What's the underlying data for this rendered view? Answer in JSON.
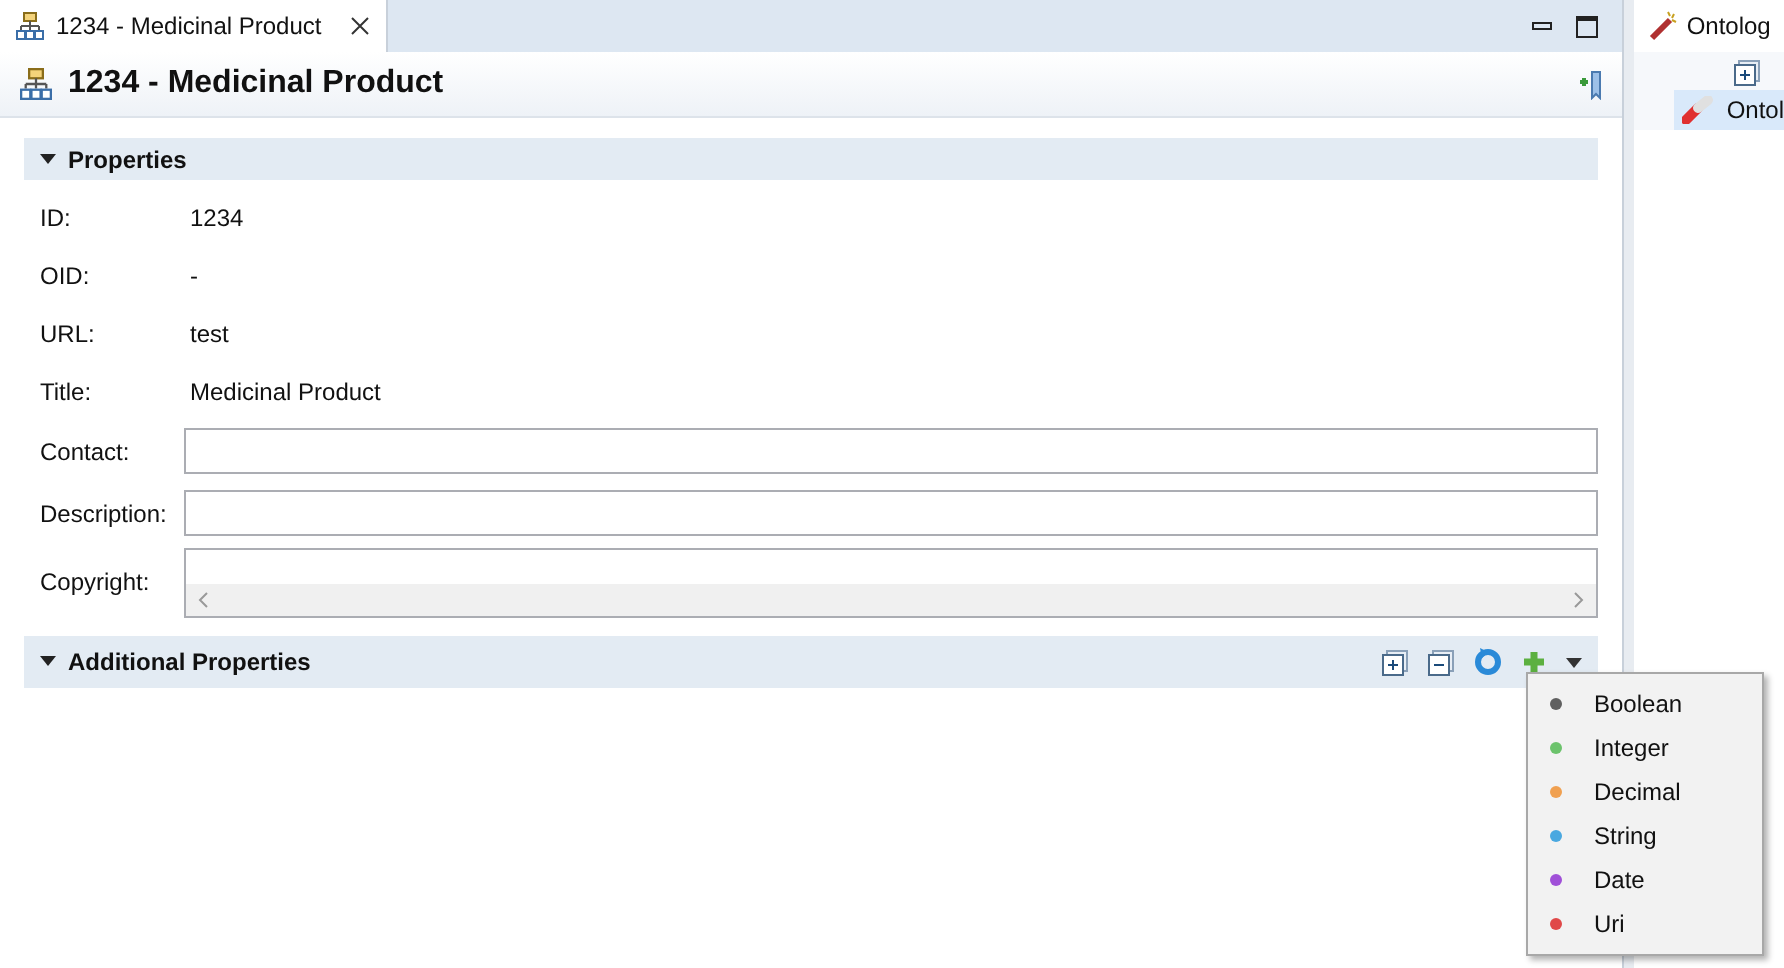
{
  "editor_tab": {
    "title": "1234 - Medicinal Product",
    "selected": true
  },
  "header": {
    "title": "1234 - Medicinal Product"
  },
  "properties": {
    "title": "Properties",
    "expanded": true,
    "fields": [
      {
        "kind": "text",
        "label": "ID:",
        "value": "1234"
      },
      {
        "kind": "text",
        "label": "OID:",
        "value": "-"
      },
      {
        "kind": "text",
        "label": "URL:",
        "value": "test"
      },
      {
        "kind": "text",
        "label": "Title:",
        "value": "Medicinal Product"
      },
      {
        "kind": "input",
        "label": "Contact:"
      },
      {
        "kind": "input",
        "label": "Description:"
      },
      {
        "kind": "textarea",
        "label": "Copyright:"
      }
    ]
  },
  "additional_properties": {
    "title": "Additional Properties",
    "expanded": true
  },
  "type_menu": [
    {
      "label": "Boolean",
      "color": "#606060"
    },
    {
      "label": "Integer",
      "color": "#6cc36c"
    },
    {
      "label": "Decimal",
      "color": "#f0a050"
    },
    {
      "label": "String",
      "color": "#4aa8e0"
    },
    {
      "label": "Date",
      "color": "#a050d8"
    },
    {
      "label": "Uri",
      "color": "#e04848"
    }
  ],
  "side_panel": {
    "tab": "Ontolog",
    "tree_item": {
      "label": "Ontol",
      "selected": true
    }
  }
}
